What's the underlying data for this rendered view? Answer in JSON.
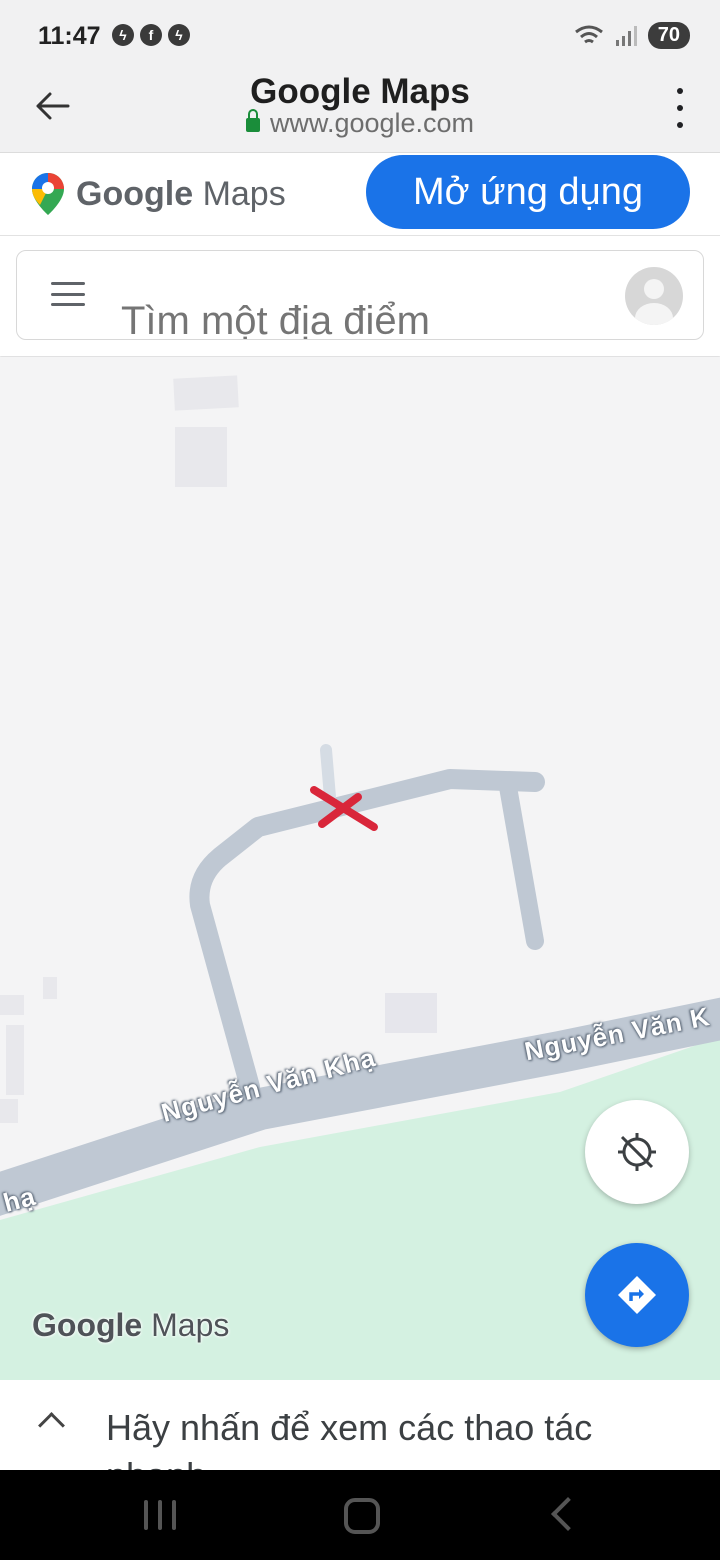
{
  "status_bar": {
    "time": "11:47",
    "notification_icons": [
      "messenger-icon",
      "facebook-icon",
      "messenger-icon"
    ],
    "battery": "70"
  },
  "browser": {
    "title": "Google Maps",
    "url": "www.google.com"
  },
  "banner": {
    "brand_google": "Google",
    "brand_maps": "Maps",
    "open_app_label": "Mở ứng dụng"
  },
  "search": {
    "placeholder": "Tìm một địa điểm"
  },
  "map": {
    "street_labels": [
      "Nguyễn Văn Khạ",
      "Nguyễn Văn K",
      "hạ"
    ],
    "marker": "red-x-marker",
    "logo_google": "Google",
    "logo_maps": "Maps",
    "colors": {
      "road": "#bfc8d3",
      "park": "#d4f1e1",
      "marker": "#d9263a",
      "accent": "#1a73e8"
    }
  },
  "bottom_sheet": {
    "text": "Hãy nhấn để xem các thao tác nhanh"
  }
}
